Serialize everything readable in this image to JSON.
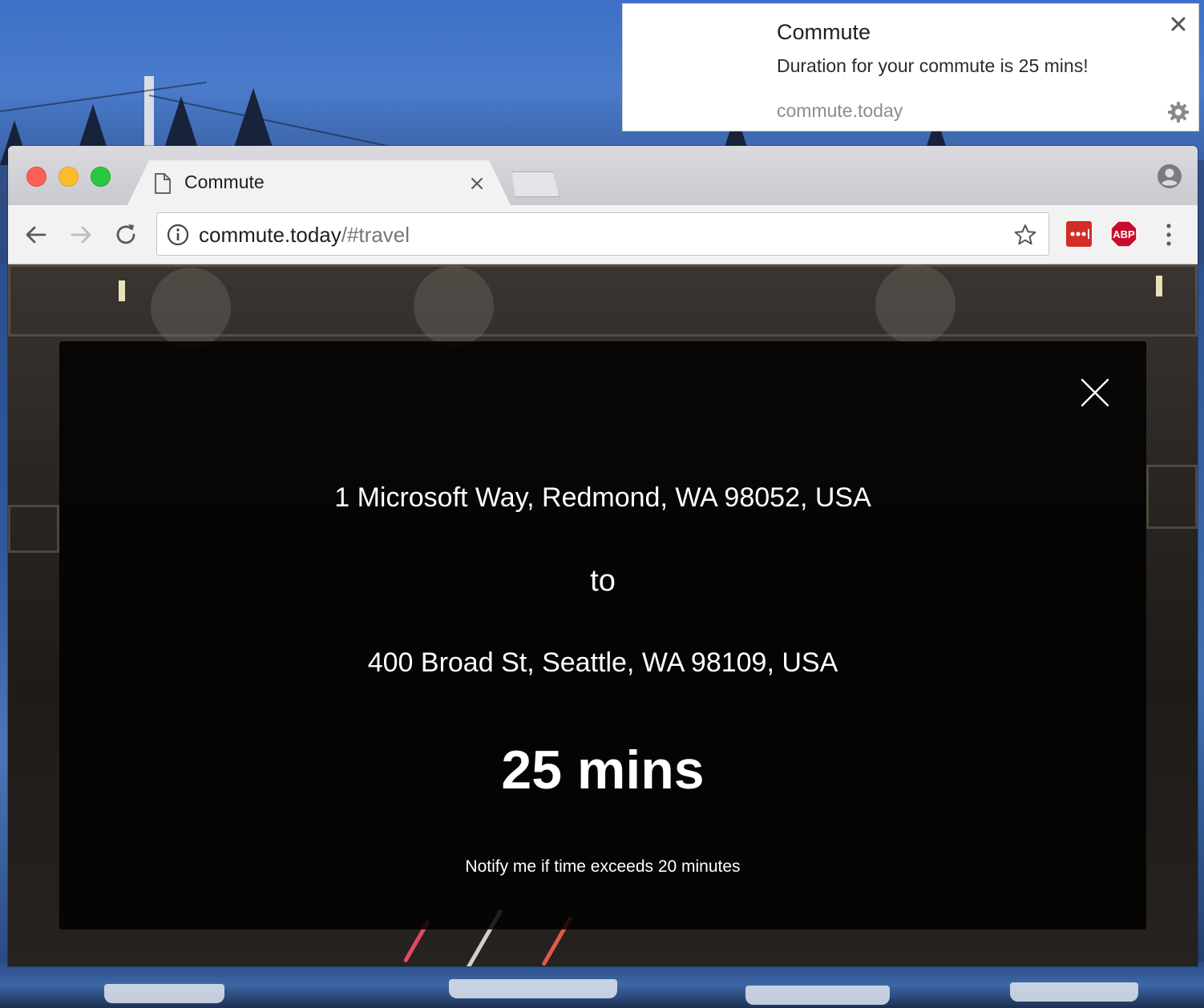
{
  "notification": {
    "title": "Commute",
    "message": "Duration for your commute is 25 mins!",
    "source": "commute.today"
  },
  "browser": {
    "tab": {
      "title": "Commute"
    },
    "address_bar": {
      "host": "commute.today",
      "path": "/#travel"
    },
    "extensions": [
      "lastpass-icon",
      "adblock-plus-icon"
    ],
    "abp_label": "ABP"
  },
  "page": {
    "origin": "1 Microsoft Way, Redmond, WA 98052, USA",
    "connector": "to",
    "destination": "400 Broad St, Seattle, WA 98109, USA",
    "duration": "25 mins",
    "notify_text": "Notify me if time exceeds 20 minutes"
  },
  "colors": {
    "close_red": "#fc5f57",
    "minimize_yellow": "#fdbc2e",
    "zoom_green": "#28c840",
    "lastpass_red": "#d32d27",
    "abp_red": "#c70d2c"
  }
}
